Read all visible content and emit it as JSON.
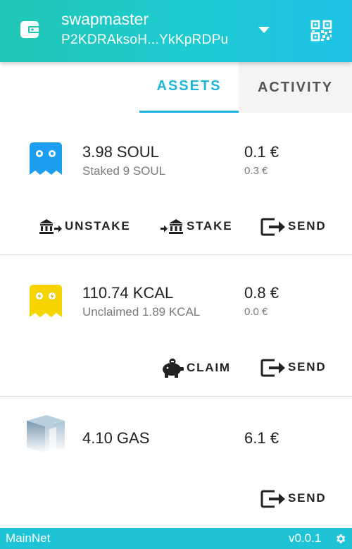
{
  "header": {
    "account_name": "swapmaster",
    "address": "P2KDRAksoH...YkKpRDPu"
  },
  "tabs": [
    {
      "label": "ASSETS",
      "active": true
    },
    {
      "label": "ACTIVITY",
      "active": false
    }
  ],
  "assets": [
    {
      "amount": "3.98 SOUL",
      "sub": "Staked 9 SOUL",
      "value": "0.1 €",
      "sub_value": "0.3 €",
      "icon": "soul-ghost-icon",
      "actions": [
        "UNSTAKE",
        "STAKE",
        "SEND"
      ]
    },
    {
      "amount": "110.74 KCAL",
      "sub": "Unclaimed 1.89 KCAL",
      "value": "0.8 €",
      "sub_value": "0.0 €",
      "icon": "kcal-ghost-icon",
      "actions": [
        "CLAIM",
        "SEND"
      ]
    },
    {
      "amount": "4.10 GAS",
      "value": "6.1 €",
      "icon": "gas-cube-icon",
      "actions": [
        "SEND"
      ]
    }
  ],
  "footer": {
    "network": "MainNet",
    "version": "v0.0.1"
  },
  "colors": {
    "accent": "#1fb3dc",
    "header_start": "#1fc7b4",
    "header_end": "#1fc2e6",
    "soul": "#1e9ef0",
    "kcal": "#f5d400"
  }
}
